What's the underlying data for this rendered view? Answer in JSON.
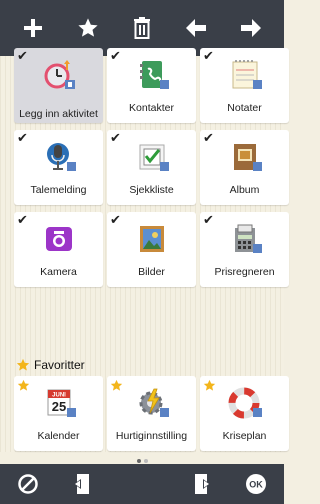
{
  "toolbar": {
    "icons": [
      "plus-icon",
      "star-icon",
      "trash-icon",
      "arrow-left-icon",
      "arrow-right-icon"
    ]
  },
  "tiles": [
    {
      "label": "Legg inn aktivitet",
      "icon": "add-activity-icon",
      "mark": "check",
      "selected": true
    },
    {
      "label": "Kontakter",
      "icon": "contacts-icon",
      "mark": "check"
    },
    {
      "label": "Notater",
      "icon": "notes-icon",
      "mark": "check"
    },
    {
      "label": "Talemelding",
      "icon": "voice-message-icon",
      "mark": "check"
    },
    {
      "label": "Sjekkliste",
      "icon": "checklist-icon",
      "mark": "check"
    },
    {
      "label": "Album",
      "icon": "album-icon",
      "mark": "check"
    },
    {
      "label": "Kamera",
      "icon": "camera-icon",
      "mark": "check"
    },
    {
      "label": "Bilder",
      "icon": "pictures-icon",
      "mark": "check"
    },
    {
      "label": "Prisregneren",
      "icon": "price-calculator-icon",
      "mark": "check"
    }
  ],
  "favorites": {
    "title": "Favoritter",
    "tiles": [
      {
        "label": "Kalender",
        "icon": "calendar-icon",
        "calendar_month": "JUNI",
        "calendar_day": "25"
      },
      {
        "label": "Hurtiginnstilling",
        "icon": "quick-settings-icon"
      },
      {
        "label": "Kriseplan",
        "icon": "crisis-plan-icon"
      }
    ]
  },
  "pager": {
    "pages": 2,
    "current": 1
  },
  "bottombar": {
    "icons": [
      "block-icon",
      "exit-left-icon",
      "exit-right-icon",
      "ok-icon"
    ],
    "ok_label": "OK"
  },
  "colors": {
    "bar": "#3a3f48",
    "background": "#f4f0e2",
    "tile": "#ffffff",
    "tile_selected": "#d9d9de",
    "favorite_star": "#f3b51b"
  }
}
